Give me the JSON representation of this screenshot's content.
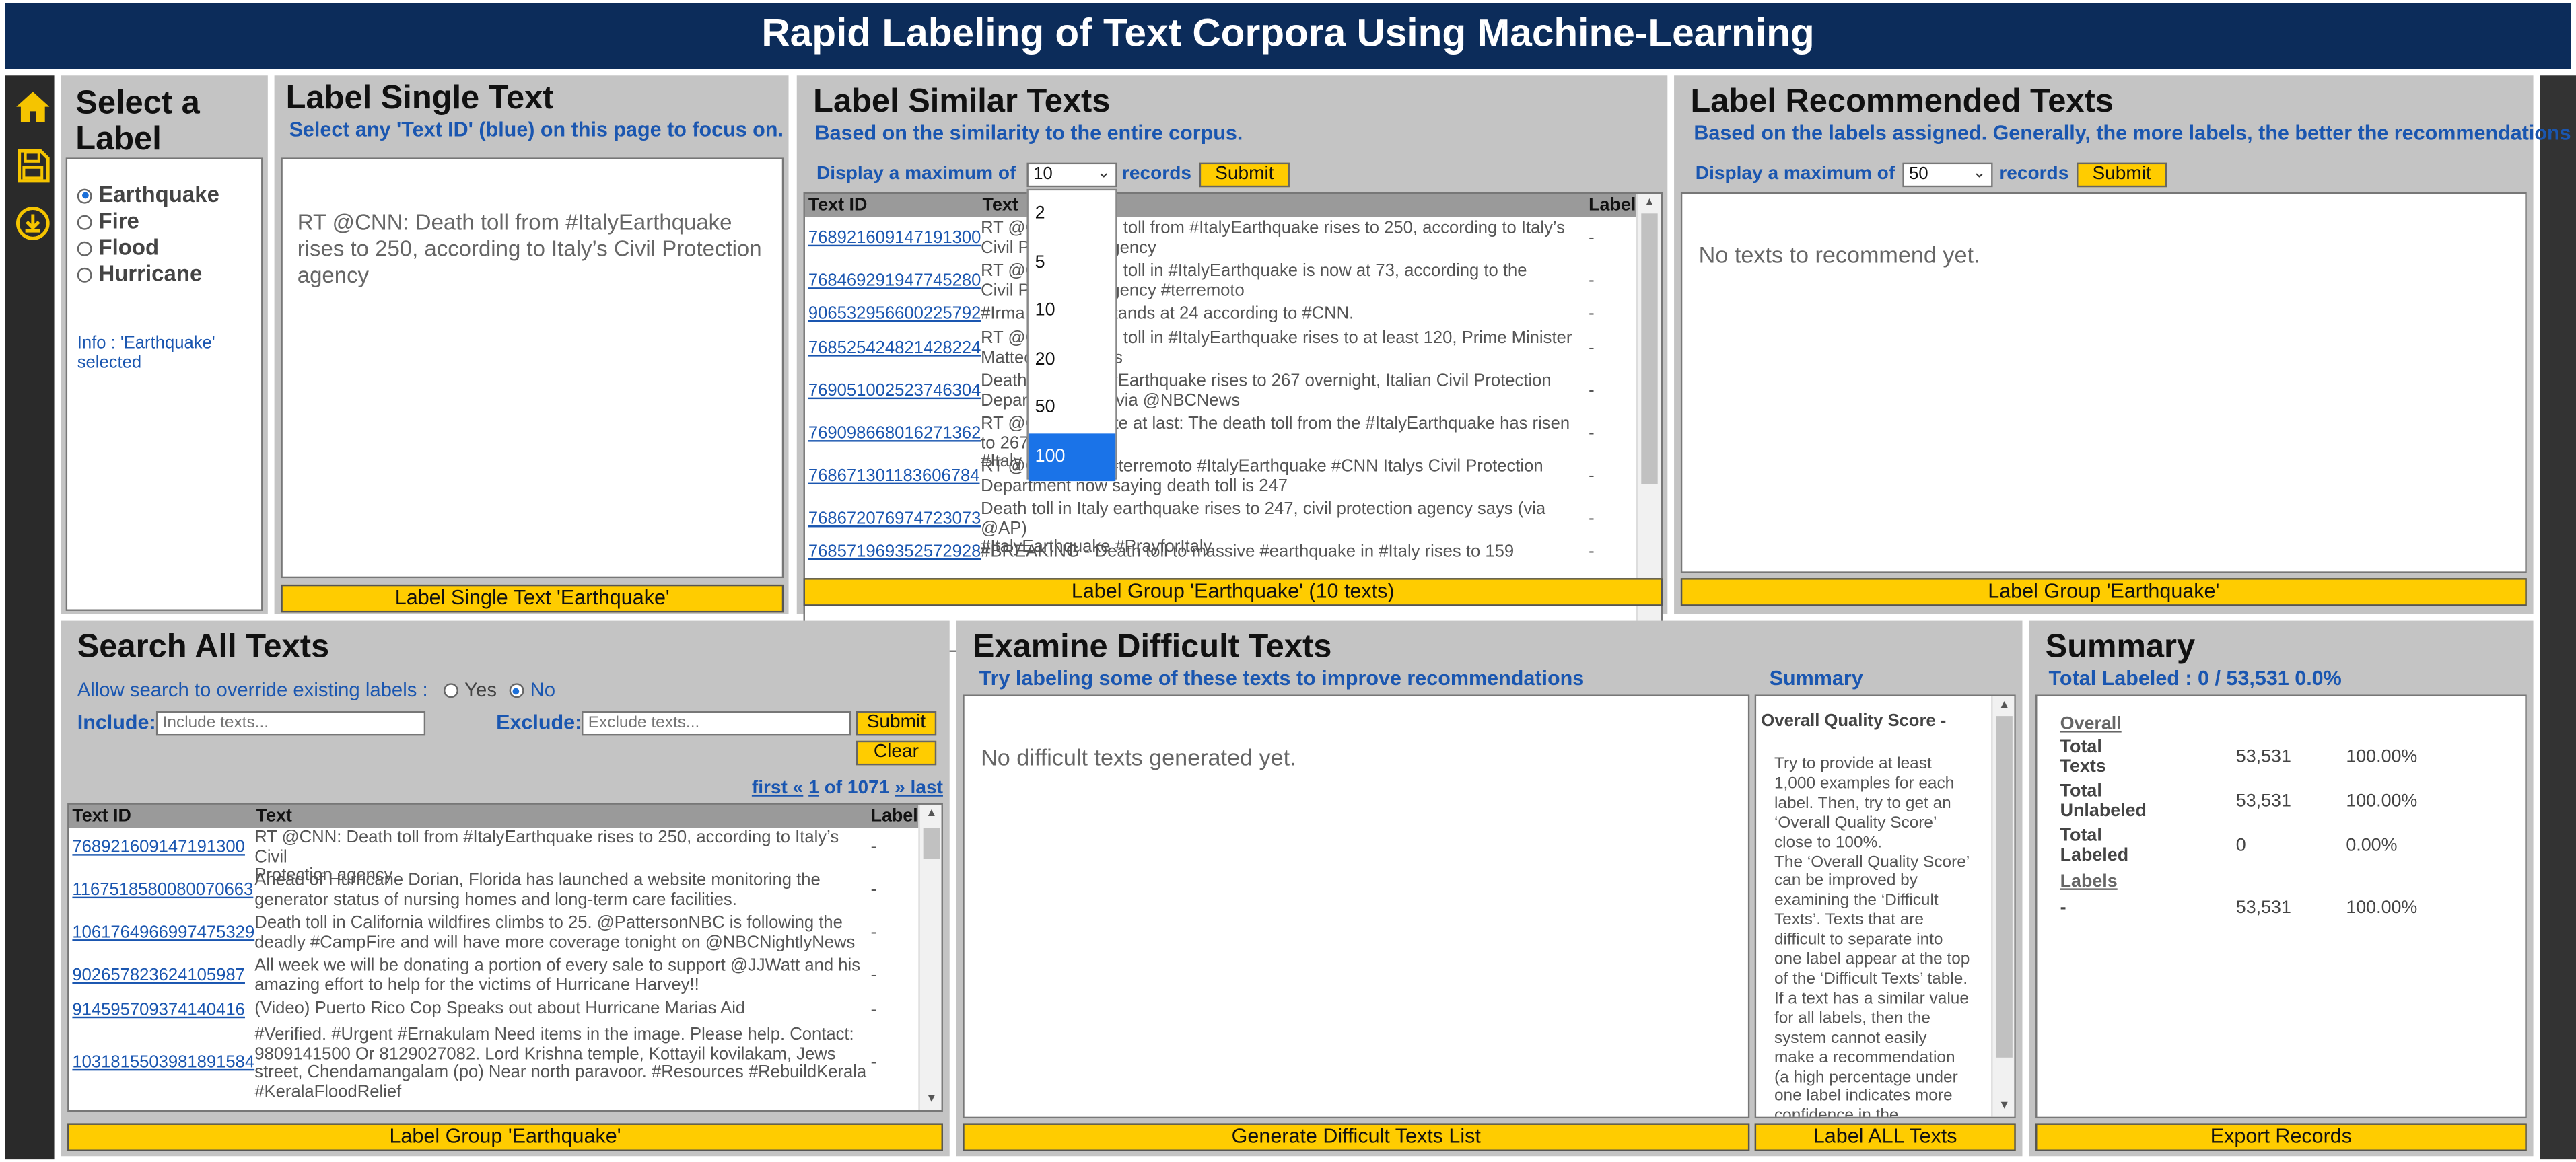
{
  "app": {
    "title": "Rapid Labeling of Text Corpora Using Machine-Learning"
  },
  "colors": {
    "header_bg": "#0c2c5a",
    "accent_button": "#ffcc00",
    "link_blue": "#1a56b0",
    "panel_gray": "#c4c4c4",
    "sidebar_icon": "#f5c400"
  },
  "sidebar": {
    "icons": [
      "home-icon",
      "save-icon",
      "download-icon"
    ]
  },
  "select_label": {
    "title_line1": "Select a",
    "title_line2": "Label",
    "options": [
      {
        "label": "Earthquake",
        "selected": true
      },
      {
        "label": "Fire",
        "selected": false
      },
      {
        "label": "Flood",
        "selected": false
      },
      {
        "label": "Hurricane",
        "selected": false
      }
    ],
    "info_line1": "Info : 'Earthquake'",
    "info_line2": "selected"
  },
  "single_text": {
    "title": "Label Single Text",
    "subtitle": "Select any 'Text ID' (blue) on this page to focus on.",
    "text": "RT @CNN: Death toll from #ItalyEarthquake rises to 250, according to Italy’s Civil Protection agency",
    "button": "Label Single Text 'Earthquake'"
  },
  "similar": {
    "title": "Label Similar Texts",
    "subtitle": "Based on the similarity to the entire corpus.",
    "display_prefix": "Display a maximum of",
    "display_value": "10",
    "display_suffix": "records",
    "submit": "Submit",
    "dropdown_options": [
      "2",
      "5",
      "10",
      "20",
      "50",
      "100"
    ],
    "dropdown_highlighted": "100",
    "columns": [
      "Text ID",
      "Text",
      "Label"
    ],
    "rows": [
      {
        "id": "768921609147191300",
        "text_l1": "RT @CNN: Death toll from #ItalyEarthquake rises to 250, according to Italy’s",
        "text_l2": "Civil Protection agency",
        "label": "-"
      },
      {
        "id": "768469291947745280",
        "text_l1": "RT @CNN: Death toll in #ItalyEarthquake is now at 73, according to the",
        "text_l2": "Civil Protection agency #terremoto",
        "label": "-"
      },
      {
        "id": "906532956600225792",
        "text_l1": "#Irma death toll stands at 24 according to #CNN.",
        "text_l2": "",
        "label": "-"
      },
      {
        "id": "768525424821428224",
        "text_l1": "RT @CNN: Death toll in #ItalyEarthquake rises to at least 120, Prime Minister",
        "text_l2": "Matteo Renzi says",
        "label": "-"
      },
      {
        "id": "769051002523746304",
        "text_l1": "Death toll in #ItalyEarthquake rises to 267 overnight, Italian Civil Protection",
        "text_l2": "Department says via @NBCNews",
        "label": "-"
      },
      {
        "id": "769098668016271362",
        "text_l1": "RT @CNN: Update at last: The death toll from the #ItalyEarthquake has risen to 267",
        "text_l2": "#Italy says",
        "label": "-"
      },
      {
        "id": "768671301183606784",
        "text_l1": "RT @CNN: Italy #terremoto #ItalyEarthquake #CNN Italys Civil Protection",
        "text_l2": "Department now saying death toll is 247",
        "label": "-"
      },
      {
        "id": "768672076974723073",
        "text_l1": "Death toll in Italy earthquake rises to 247, civil protection agency says (via @AP)",
        "text_l2": "#ItalyEarthquake #PrayforItaly",
        "label": "-"
      },
      {
        "id": "768571969352572928",
        "text_l1": "#BREAKING - Death toll to massive #earthquake in #Italy rises to 159",
        "text_l2": "",
        "label": "-"
      }
    ],
    "button": "Label Group 'Earthquake' (10 texts)"
  },
  "recommended": {
    "title": "Label Recommended Texts",
    "subtitle": "Based on the labels assigned. Generally, the more labels, the better the recommendations",
    "display_prefix": "Display a maximum of",
    "display_value": "50",
    "display_suffix": "records",
    "submit": "Submit",
    "empty": "No texts to recommend yet.",
    "button": "Label Group 'Earthquake'"
  },
  "search": {
    "title": "Search All Texts",
    "override_label": "Allow search to override existing labels :",
    "yes": "Yes",
    "no": "No",
    "include_label": "Include:",
    "include_placeholder": "Include texts...",
    "exclude_label": "Exclude:",
    "exclude_placeholder": "Exclude texts...",
    "submit": "Submit",
    "clear": "Clear",
    "pager": {
      "first": "first «",
      "page": "1",
      "of": "of 1071",
      "last": "» last"
    },
    "columns": [
      "Text ID",
      "Text",
      "Label"
    ],
    "rows": [
      {
        "id": "768921609147191300",
        "text_l1": "RT @CNN: Death toll from #ItalyEarthquake rises to 250, according to Italy’s Civil",
        "text_l2": "Protection agency",
        "text_l3": "",
        "label": "-"
      },
      {
        "id": "1167518580080070663",
        "text_l1": "Ahead of Hurricane Dorian, Florida has launched a website monitoring the",
        "text_l2": "generator status of nursing homes and long-term care facilities.",
        "text_l3": "",
        "label": "-"
      },
      {
        "id": "1061764966997475329",
        "text_l1": "Death toll in California wildfires climbs to 25. @PattersonNBC is following the",
        "text_l2": "deadly #CampFire and will have more coverage tonight on @NBCNightlyNews",
        "text_l3": "",
        "label": "-"
      },
      {
        "id": "902657823624105987",
        "text_l1": "All week we will be donating a portion of every sale to support @JJWatt and his",
        "text_l2": "amazing effort to help for the victims of Hurricane Harvey!!",
        "text_l3": "",
        "label": "-"
      },
      {
        "id": "914595709374140416",
        "text_l1": "(Video) Puerto Rico Cop Speaks out about Hurricane Marias Aid",
        "text_l2": "",
        "text_l3": "",
        "label": "-"
      },
      {
        "id": "1031815503981891584",
        "text_l1": "#Verified. #Urgent #Ernakulam Need items in the image. Please help. Contact:",
        "text_l2": "9809141500 Or 8129027082. Lord Krishna temple, Kottayil kovilakam, Jews",
        "text_l3": "street, Chendamangalam (po) Near north paravoor. #Resources #RebuildKerala",
        "text_l4": "#KeralaFloodRelief",
        "label": "-"
      }
    ],
    "button": "Label Group 'Earthquake'"
  },
  "difficult": {
    "title": "Examine Difficult Texts",
    "subtitle": "Try labeling some of these texts to improve recommendations",
    "summary_label": "Summary",
    "empty": "No difficult texts generated yet.",
    "quality_title": "Overall Quality Score -",
    "quality_text": [
      "Try to provide at least",
      "1,000 examples for each",
      "label. Then, try to get an",
      "‘Overall Quality Score’",
      "close to 100%.",
      "The ‘Overall Quality Score’",
      "can be improved by",
      "examining the ‘Difficult",
      "Texts’. Texts that are",
      "difficult to separate into",
      "one label appear at the top",
      "of the ‘Difficult Texts’ table.",
      "If a text has a similar value",
      "for all labels, then the",
      "system cannot easily",
      "make a recommendation",
      "(a high percentage under",
      "one label indicates more",
      "confidence in the"
    ],
    "generate_button": "Generate Difficult Texts List",
    "label_all_button": "Label ALL Texts"
  },
  "summary": {
    "title": "Summary",
    "total_labeled_line": "Total Labeled : 0 / 53,531 0.0%",
    "overall_heading": "Overall",
    "rows": [
      {
        "name_l1": "Total",
        "name_l2": "Texts",
        "count": "53,531",
        "pct": "100.00%"
      },
      {
        "name_l1": "Total",
        "name_l2": "Unlabeled",
        "count": "53,531",
        "pct": "100.00%"
      },
      {
        "name_l1": "Total",
        "name_l2": "Labeled",
        "count": "0",
        "pct": "0.00%"
      }
    ],
    "labels_heading": "Labels",
    "label_rows": [
      {
        "name": "-",
        "count": "53,531",
        "pct": "100.00%"
      }
    ],
    "button": "Export Records"
  }
}
